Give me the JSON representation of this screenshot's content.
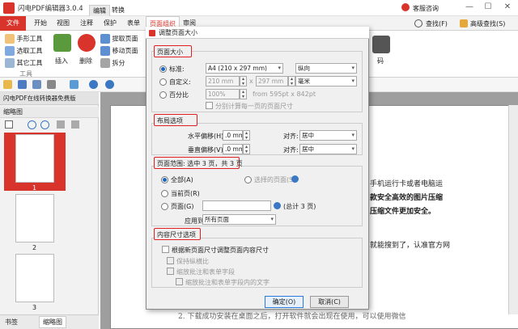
{
  "titlebar": {
    "app_title": "闪电PDF编辑器3.0.4",
    "tab_edit": "编辑",
    "tab_convert": "转换",
    "help_label": "客服咨询",
    "min": "—",
    "max": "☐",
    "close": "✕"
  },
  "menu": {
    "file": "文件",
    "items": [
      "开始",
      "视图",
      "注释",
      "保护",
      "表单",
      "页面组织",
      "审阅"
    ],
    "right_find": "查找(F)",
    "right_adv_find": "高级查找(S)"
  },
  "ribbon": {
    "hand_tool": "手形工具",
    "select_tool": "选取工具",
    "other_tools": "其它工具",
    "tools_group": "工具",
    "insert": "插入",
    "delete": "删除",
    "extract": "提取页面",
    "move": "移动页面",
    "split": "拆分",
    "code": "码"
  },
  "left_panel": {
    "header": "缩略图",
    "tab_title": "闪电PDF在线转换器免费版",
    "page_labels": [
      "1",
      "2",
      "3"
    ],
    "bottom_tabs": [
      "书签",
      "缩略图"
    ]
  },
  "document": {
    "lines": [
      "手机运行卡或者电脑运",
      "款安全高效的图片压缩",
      "压缩文件更加安全。",
      "就能搜到了，认准官方网"
    ],
    "bottom_line": "2.  下载成功安装在桌面之后，打开软件就会出现在使用，可以使用微信"
  },
  "dialog": {
    "title": "调整页面大小",
    "page_size": {
      "header": "页面大小",
      "standard": "标准:",
      "standard_value": "A4 (210 x 297 mm)",
      "orientation": "纵向",
      "custom": "自定义:",
      "width": "210 mm",
      "x": "x",
      "height": "297 mm",
      "unit": "毫米",
      "percent": "百分比",
      "percent_value": "100%",
      "from_text": "from 595pt x 842pt",
      "calc_each": "分别计算每一页的页面尺寸"
    },
    "layout": {
      "header": "布局选项",
      "h_offset": "水平偏移(H):",
      "h_value": ".0 mm",
      "align1": "对齐:",
      "align1_value": "居中",
      "v_offset": "垂直偏移(V):",
      "v_value": ".0 mm",
      "align2": "对齐:",
      "align2_value": "居中"
    },
    "range": {
      "header": "页面范围: 选中 3 页，共 3 页",
      "all": "全部(A)",
      "selected": "选择的页面(S)",
      "current": "当前页(R)",
      "pages": "页面(G)",
      "total": "(总计 3 页)",
      "apply_to": "应用到:",
      "apply_value": "所有页面"
    },
    "content": {
      "header": "内容尺寸选项",
      "resize": "根据新页面尺寸调整页面内容尺寸",
      "keep_ratio": "保持纵横比",
      "scale_annot": "缩放批注和表单字段",
      "scale_annot_content": "缩放批注和表单字段内的文字"
    },
    "ok": "确定(O)",
    "cancel": "取消(C)"
  }
}
